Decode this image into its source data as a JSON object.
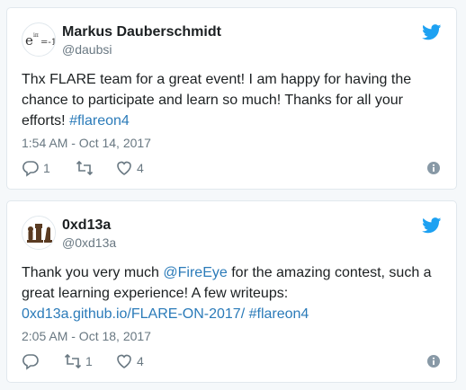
{
  "tweets": [
    {
      "name": "Markus Dauberschmidt",
      "handle": "@daubsi",
      "text_parts": [
        "Thx FLARE team for a great event! I am happy for having the chance to participate and learn so much! Thanks for all your efforts! ",
        "#flareon4"
      ],
      "timestamp": "1:54 AM - Oct 14, 2017",
      "reply_count": "1",
      "retweet_count": "",
      "like_count": "4"
    },
    {
      "name": "0xd13a",
      "handle": "@0xd13a",
      "text_parts": [
        "Thank you very much ",
        "@FireEye",
        " for the amazing contest, such a great learning experience! A few writeups: ",
        "0xd13a.github.io/FLARE-ON-2017/",
        " ",
        "#flareon4"
      ],
      "timestamp": "2:05 AM - Oct 18, 2017",
      "reply_count": "",
      "retweet_count": "1",
      "like_count": "4"
    }
  ],
  "colors": {
    "twitter_blue": "#1da1f2",
    "link": "#2b7bb9",
    "muted": "#697882"
  },
  "icons": [
    "twitter-bird-icon",
    "reply-icon",
    "retweet-icon",
    "like-icon",
    "info-icon"
  ]
}
